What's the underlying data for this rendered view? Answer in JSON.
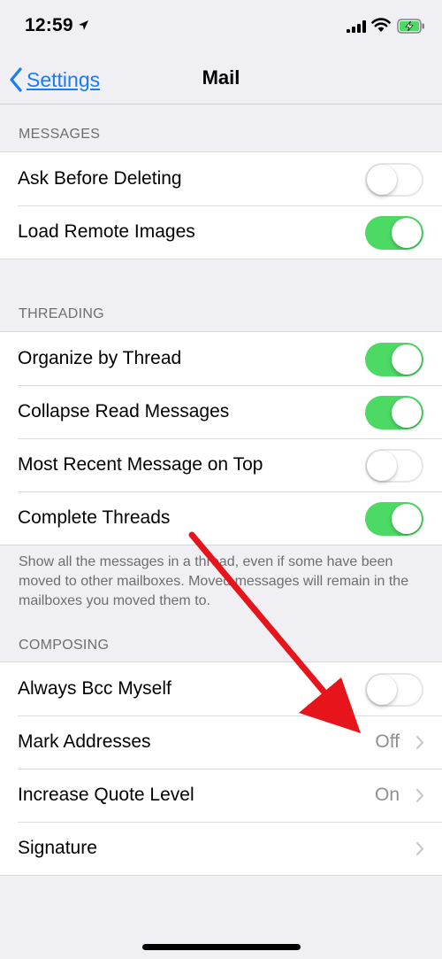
{
  "status_bar": {
    "time": "12:59"
  },
  "nav": {
    "back_label": "Settings",
    "title": "Mail"
  },
  "sections": {
    "messages": {
      "header": "MESSAGES",
      "rows": [
        {
          "label": "Ask Before Deleting",
          "toggle": "off"
        },
        {
          "label": "Load Remote Images",
          "toggle": "on"
        }
      ]
    },
    "threading": {
      "header": "THREADING",
      "rows": [
        {
          "label": "Organize by Thread",
          "toggle": "on"
        },
        {
          "label": "Collapse Read Messages",
          "toggle": "on"
        },
        {
          "label": "Most Recent Message on Top",
          "toggle": "off"
        },
        {
          "label": "Complete Threads",
          "toggle": "on"
        }
      ],
      "footer": "Show all the messages in a thread, even if some have been moved to other mailboxes. Moved messages will remain in the mailboxes you moved them to."
    },
    "composing": {
      "header": "COMPOSING",
      "rows": [
        {
          "label": "Always Bcc Myself",
          "toggle": "off"
        },
        {
          "label": "Mark Addresses",
          "value": "Off"
        },
        {
          "label": "Increase Quote Level",
          "value": "On"
        },
        {
          "label": "Signature"
        }
      ]
    }
  },
  "colors": {
    "accent": "#1a7cf5",
    "toggle_on": "#4cd964",
    "annotation_arrow": "#e8141c",
    "background": "#efeff4"
  },
  "icons": [
    "location-arrow-icon",
    "cellular-signal-icon",
    "wifi-icon",
    "battery-charging-icon",
    "chevron-left-icon",
    "chevron-right-icon",
    "annotation-arrow"
  ]
}
